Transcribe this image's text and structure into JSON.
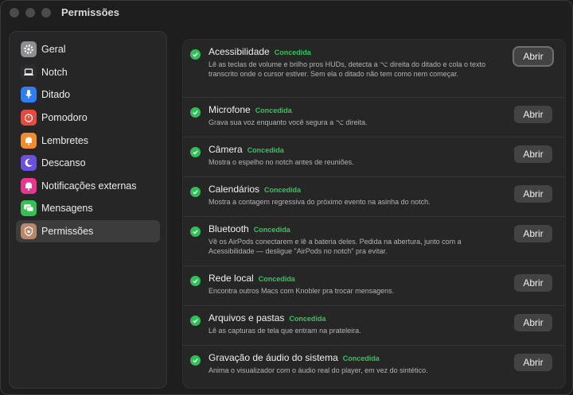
{
  "window": {
    "title": "Permissões"
  },
  "sidebar": {
    "items": [
      {
        "label": "Geral",
        "icon": "gear-icon",
        "color": "#8e8e93"
      },
      {
        "label": "Notch",
        "icon": "laptop-icon",
        "color": "#2c2c2e"
      },
      {
        "label": "Ditado",
        "icon": "microphone-icon",
        "color": "#2f7df6"
      },
      {
        "label": "Pomodoro",
        "icon": "timer-icon",
        "color": "#e84a3f"
      },
      {
        "label": "Lembretes",
        "icon": "bell-icon",
        "color": "#f08c2c"
      },
      {
        "label": "Descanso",
        "icon": "moon-icon",
        "color": "#6a4fe0"
      },
      {
        "label": "Notificações externas",
        "icon": "bell-badge-icon",
        "color": "#e8368f"
      },
      {
        "label": "Mensagens",
        "icon": "chat-icon",
        "color": "#33c24f"
      },
      {
        "label": "Permissões",
        "icon": "shield-icon",
        "color": "#b8876a"
      }
    ]
  },
  "permissions": [
    {
      "title": "Acessibilidade",
      "status": "Concedida",
      "desc": "Lê as teclas de volume e brilho pros HUDs, detecta a ⌥ direita do ditado e cola o texto transcrito onde o cursor estiver. Sem ela o ditado não tem como nem começar.",
      "button": "Abrir"
    },
    {
      "title": "Microfone",
      "status": "Concedida",
      "desc": "Grava sua voz enquanto você segura a ⌥ direita.",
      "button": "Abrir"
    },
    {
      "title": "Câmera",
      "status": "Concedida",
      "desc": "Mostra o espelho no notch antes de reuniões.",
      "button": "Abrir"
    },
    {
      "title": "Calendários",
      "status": "Concedida",
      "desc": "Mostra a contagem regressiva do próximo evento na asinha do notch.",
      "button": "Abrir"
    },
    {
      "title": "Bluetooth",
      "status": "Concedida",
      "desc": "Vê os AirPods conectarem e lê a bateria deles. Pedida na abertura, junto com a Acessibilidade — desligue \"AirPods no notch\" pra evitar.",
      "button": "Abrir"
    },
    {
      "title": "Rede local",
      "status": "Concedida",
      "desc": "Encontra outros Macs com Knobler pra trocar mensagens.",
      "button": "Abrir"
    },
    {
      "title": "Arquivos e pastas",
      "status": "Concedida",
      "desc": "Lê as capturas de tela que entram na prateleira.",
      "button": "Abrir"
    },
    {
      "title": "Gravação de áudio do sistema",
      "status": "Concedida",
      "desc": "Anima o visualizador com o áudio real do player, em vez do sintético.",
      "button": "Abrir"
    }
  ],
  "colors": {
    "accent_green": "#36c25a",
    "button_bg": "#434343",
    "selected_bg": "#3c3c3c"
  }
}
